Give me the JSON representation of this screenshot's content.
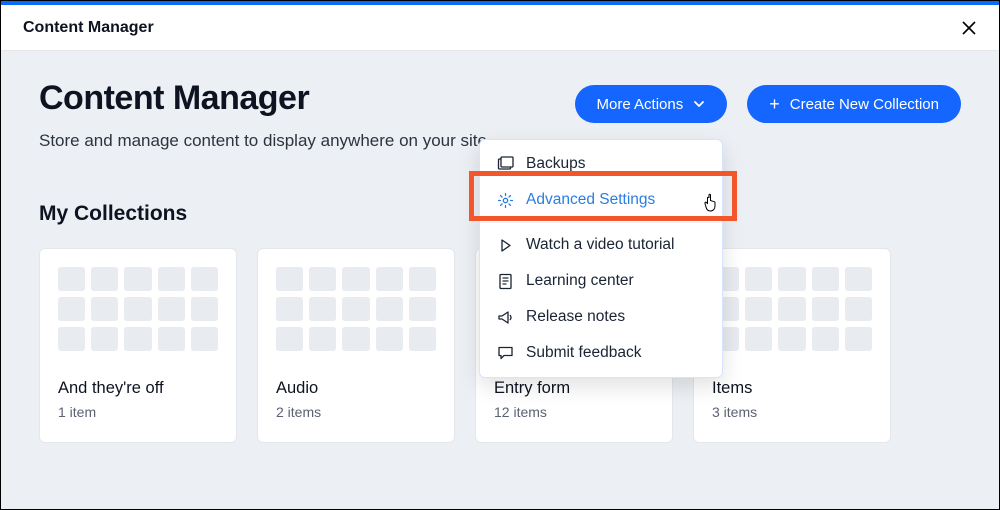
{
  "topbar": {
    "title": "Content Manager"
  },
  "header": {
    "title": "Content Manager",
    "subtitle": "Store and manage content to display anywhere on your site."
  },
  "buttons": {
    "more_actions": "More Actions",
    "create_new": "Create New Collection"
  },
  "dropdown": {
    "items": [
      {
        "label": "Backups",
        "icon": "backups-icon"
      },
      {
        "label": "Advanced Settings",
        "icon": "gear-icon"
      },
      {
        "label": "Watch a video tutorial",
        "icon": "play-icon"
      },
      {
        "label": "Learning center",
        "icon": "doc-icon"
      },
      {
        "label": "Release notes",
        "icon": "megaphone-icon"
      },
      {
        "label": "Submit feedback",
        "icon": "chat-icon"
      }
    ]
  },
  "section": {
    "title": "My Collections"
  },
  "collections": [
    {
      "title": "And they're off",
      "sub": "1 item"
    },
    {
      "title": "Audio",
      "sub": "2 items"
    },
    {
      "title": "Entry form",
      "sub": "12 items"
    },
    {
      "title": "Items",
      "sub": "3 items"
    }
  ]
}
